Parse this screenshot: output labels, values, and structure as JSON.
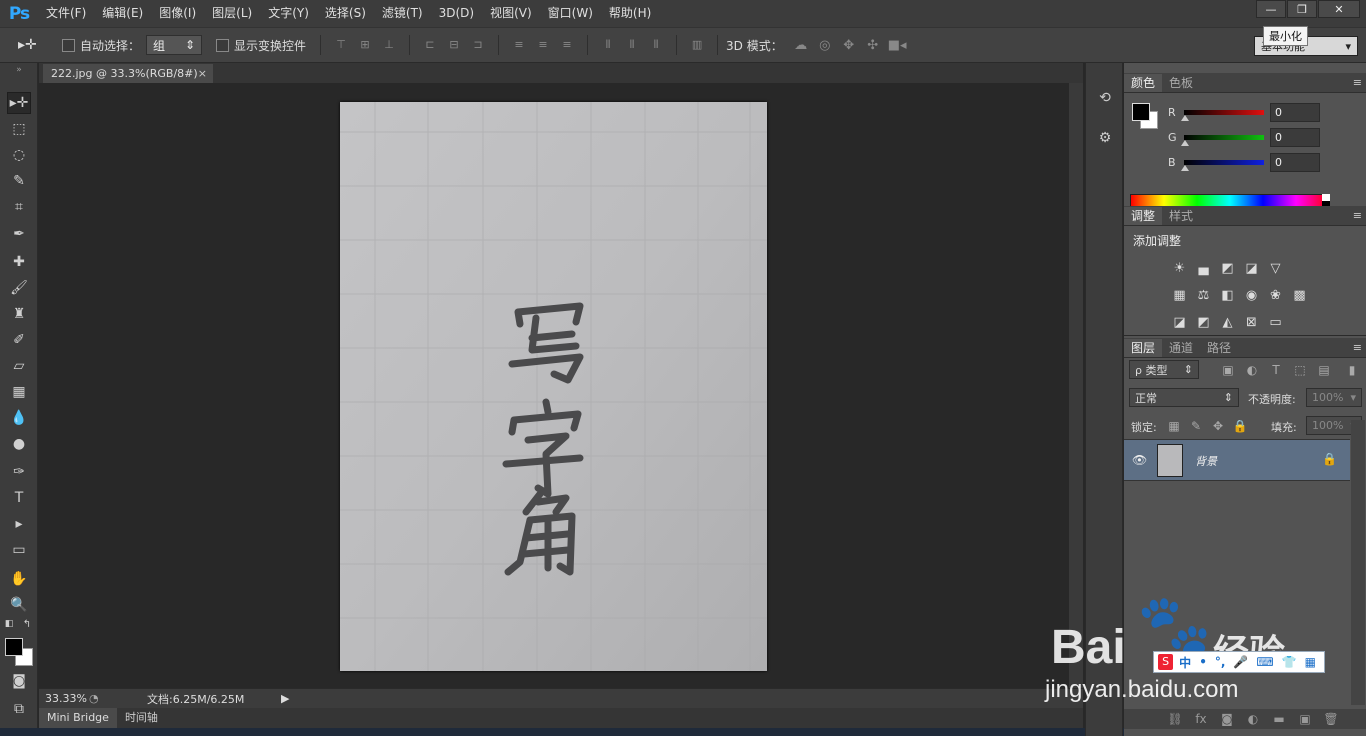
{
  "app": {
    "logo": "Ps"
  },
  "menu": [
    "文件(F)",
    "编辑(E)",
    "图像(I)",
    "图层(L)",
    "文字(Y)",
    "选择(S)",
    "滤镜(T)",
    "3D(D)",
    "视图(V)",
    "窗口(W)",
    "帮助(H)"
  ],
  "window": {
    "minimize_tooltip": "最小化",
    "minimize": "—",
    "restore": "❐",
    "close": "✕"
  },
  "options": {
    "auto_select_label": "自动选择：",
    "auto_select_value": "组",
    "show_transform_label": "显示变换控件",
    "mode3d_label": "3D 模式：",
    "workspace": "基本功能"
  },
  "document": {
    "tab_title": "222.jpg @ 33.3%(RGB/8#)",
    "close_glyph": "×",
    "zoom": "33.33%",
    "doc_info": "文档:6.25M/6.25M"
  },
  "bottom_tabs": [
    "Mini Bridge",
    "时间轴"
  ],
  "panels": {
    "color": {
      "tabs": [
        "颜色",
        "色板"
      ],
      "channels": [
        {
          "label": "R",
          "value": "0",
          "color": "#e01010"
        },
        {
          "label": "G",
          "value": "0",
          "color": "#10c010"
        },
        {
          "label": "B",
          "value": "0",
          "color": "#1020e0"
        }
      ]
    },
    "adjustments": {
      "tabs": [
        "调整",
        "样式"
      ],
      "title": "添加调整"
    },
    "layers": {
      "tabs": [
        "图层",
        "通道",
        "路径"
      ],
      "filter_type": "ρ 类型",
      "blend_mode": "正常",
      "opacity_label": "不透明度:",
      "opacity_value": "100%",
      "lock_label": "锁定:",
      "fill_label": "填充:",
      "fill_value": "100%",
      "layer_name": "背景"
    }
  },
  "watermark": {
    "brand": "Bai",
    "product": "经验",
    "url": "jingyan.baidu.com"
  },
  "ime": {
    "logo": "S",
    "items": [
      "中",
      "•",
      "°,",
      "🎤",
      "⌨",
      "👕",
      "▦"
    ]
  },
  "colors": {
    "accent": "#31a8ff",
    "layer_selected": "#5d6f85"
  }
}
